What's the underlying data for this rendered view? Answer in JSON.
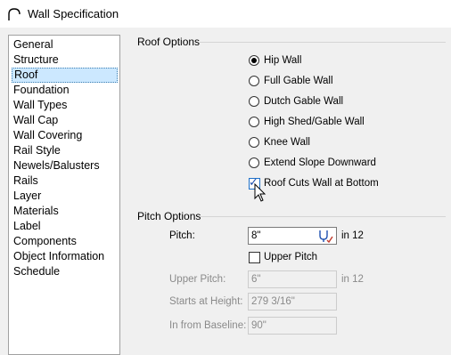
{
  "window": {
    "title": "Wall Specification",
    "icon": "arch-icon"
  },
  "sidebar": {
    "items": [
      {
        "label": "General",
        "selected": false
      },
      {
        "label": "Structure",
        "selected": false
      },
      {
        "label": "Roof",
        "selected": true
      },
      {
        "label": "Foundation",
        "selected": false
      },
      {
        "label": "Wall Types",
        "selected": false
      },
      {
        "label": "Wall Cap",
        "selected": false
      },
      {
        "label": "Wall Covering",
        "selected": false
      },
      {
        "label": "Rail Style",
        "selected": false
      },
      {
        "label": "Newels/Balusters",
        "selected": false
      },
      {
        "label": "Rails",
        "selected": false
      },
      {
        "label": "Layer",
        "selected": false
      },
      {
        "label": "Materials",
        "selected": false
      },
      {
        "label": "Label",
        "selected": false
      },
      {
        "label": "Components",
        "selected": false
      },
      {
        "label": "Object Information",
        "selected": false
      },
      {
        "label": "Schedule",
        "selected": false
      }
    ]
  },
  "roof_options": {
    "heading": "Roof Options",
    "radios": [
      {
        "label": "Hip Wall",
        "checked": true
      },
      {
        "label": "Full Gable Wall",
        "checked": false
      },
      {
        "label": "Dutch Gable Wall",
        "checked": false
      },
      {
        "label": "High Shed/Gable Wall",
        "checked": false
      },
      {
        "label": "Knee Wall",
        "checked": false
      },
      {
        "label": "Extend Slope Downward",
        "checked": false
      }
    ],
    "roof_cuts": {
      "label": "Roof Cuts Wall at Bottom",
      "checked": true
    }
  },
  "pitch_options": {
    "heading": "Pitch Options",
    "pitch": {
      "label": "Pitch:",
      "value": "8\"",
      "unit": "in 12"
    },
    "upper_pitch_checkbox": {
      "label": "Upper Pitch",
      "checked": false
    },
    "upper_pitch": {
      "label": "Upper Pitch:",
      "value": "6\"",
      "unit": "in 12"
    },
    "starts_at_height": {
      "label": "Starts at Height:",
      "value": "279 3/16\""
    },
    "in_from_baseline": {
      "label": "In from Baseline:",
      "value": "90\""
    }
  },
  "colors": {
    "selection": "#cce8ff",
    "disabled_text": "#8a8a8a",
    "accent": "#1e70c8"
  }
}
